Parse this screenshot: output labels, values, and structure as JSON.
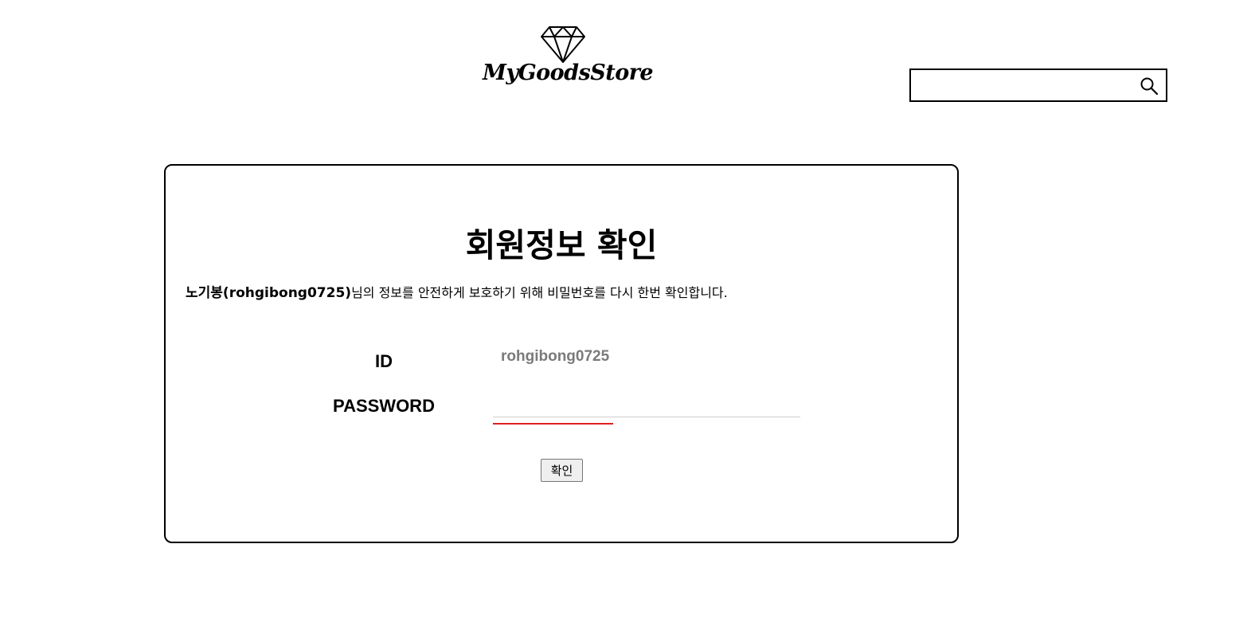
{
  "header": {
    "logo_text": "MyGoodsStore",
    "logo_icon": "diamond-icon",
    "search": {
      "value": "",
      "placeholder": "",
      "icon": "search-icon"
    }
  },
  "card": {
    "title": "회원정보 확인",
    "notice_name": "노기봉(rohgibong0725)",
    "notice_text": "님의 정보를 안전하게 보호하기 위해 비밀번호를 다시 한번 확인합니다.",
    "id_label": "ID",
    "id_value": "rohgibong0725",
    "password_label": "PASSWORD",
    "password_value": "",
    "confirm_label": "확인",
    "focus_color": "#e02020"
  }
}
